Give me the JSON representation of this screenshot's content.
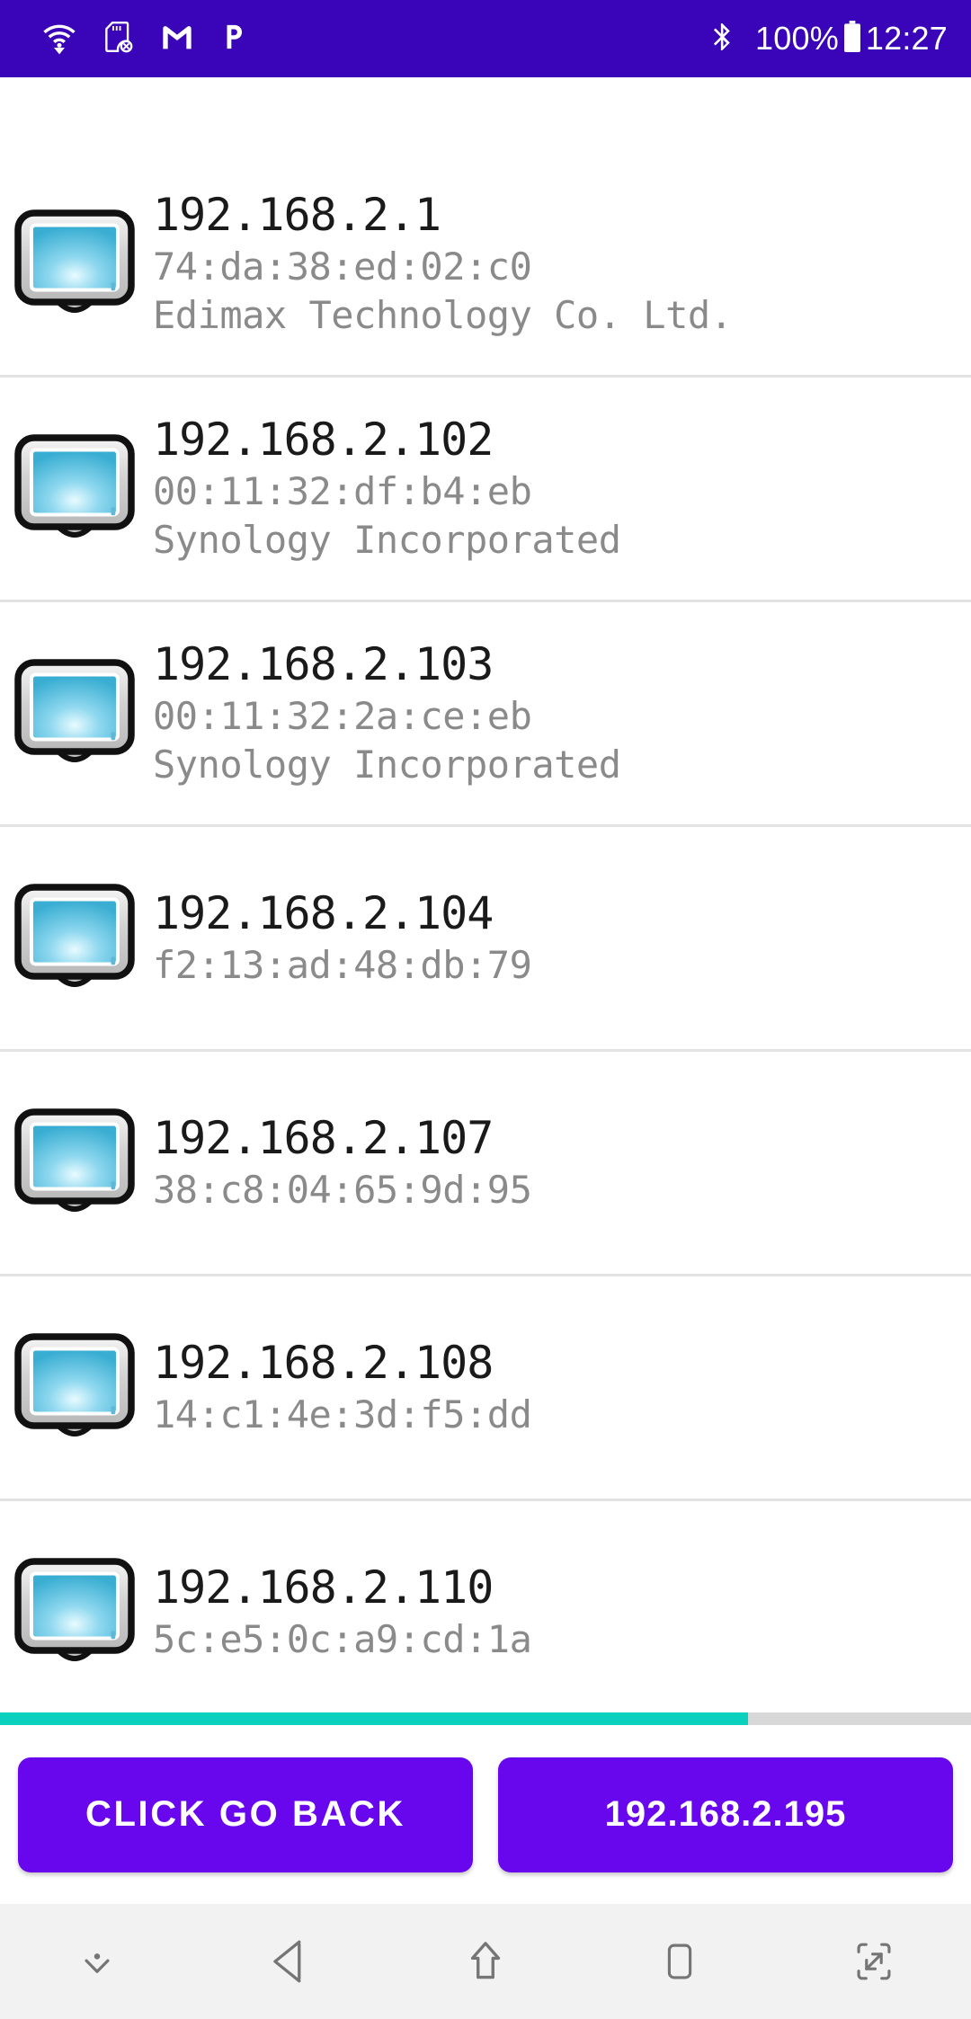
{
  "status_bar": {
    "background_color": "#3A04B8",
    "left_icons": [
      {
        "name": "wifi-icon",
        "label": "wifi"
      },
      {
        "name": "sd-card-off-icon",
        "label": "sd-card-off"
      },
      {
        "name": "gmail-icon",
        "label": "M"
      },
      {
        "name": "pushbullet-icon",
        "label": "P"
      }
    ],
    "right_icons": [
      {
        "name": "bluetooth-icon",
        "label": "bluetooth"
      },
      {
        "name": "battery-icon",
        "label": "battery"
      }
    ],
    "battery_percent": "100%",
    "clock": "12:27"
  },
  "device_list": {
    "icon_name": "computer-monitor-icon",
    "rows": [
      {
        "ip": "192.168.2.1",
        "mac": "74:da:38:ed:02:c0",
        "vendor": "Edimax Technology Co. Ltd."
      },
      {
        "ip": "192.168.2.102",
        "mac": "00:11:32:df:b4:eb",
        "vendor": "Synology Incorporated"
      },
      {
        "ip": "192.168.2.103",
        "mac": "00:11:32:2a:ce:eb",
        "vendor": "Synology Incorporated"
      },
      {
        "ip": "192.168.2.104",
        "mac": "f2:13:ad:48:db:79",
        "vendor": ""
      },
      {
        "ip": "192.168.2.107",
        "mac": "38:c8:04:65:9d:95",
        "vendor": ""
      },
      {
        "ip": "192.168.2.108",
        "mac": "14:c1:4e:3d:f5:dd",
        "vendor": ""
      },
      {
        "ip": "192.168.2.110",
        "mac": "5c:e5:0c:a9:cd:1a",
        "vendor": ""
      }
    ]
  },
  "progress": {
    "percent": 77,
    "fill_color": "#09D1BE",
    "track_color": "#d8d8d8"
  },
  "actions": {
    "accent_color": "#6807EE",
    "back_button_label": "CLICK GO BACK",
    "host_button_label": "192.168.2.195"
  },
  "nav_bar": {
    "background_color": "#F2F2F2",
    "buttons": [
      {
        "name": "hide-keyboard-icon",
        "label": "hide-keyboard"
      },
      {
        "name": "back-icon",
        "label": "back"
      },
      {
        "name": "home-icon",
        "label": "home"
      },
      {
        "name": "recents-icon",
        "label": "recents"
      },
      {
        "name": "fullscreen-icon",
        "label": "fullscreen"
      }
    ]
  }
}
